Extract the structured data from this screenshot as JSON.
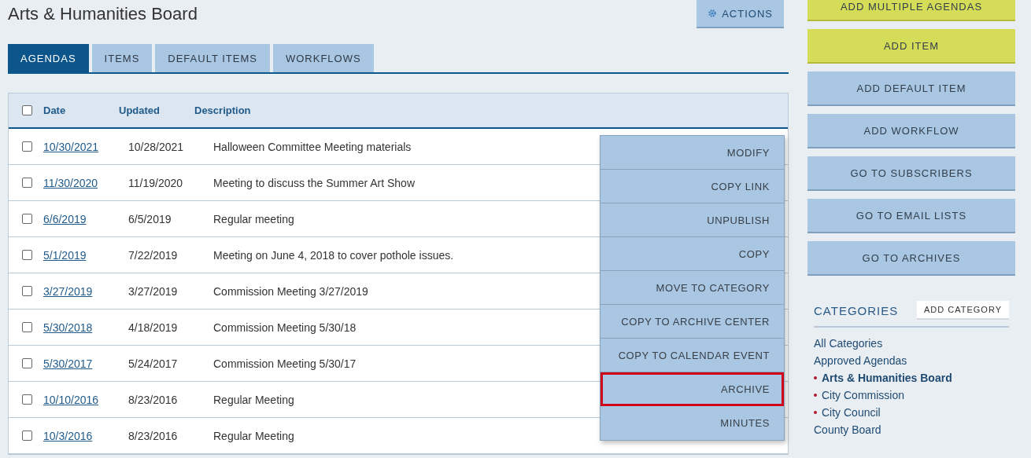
{
  "page": {
    "title": "Arts & Humanities Board",
    "actions_button": "ACTIONS"
  },
  "tabs": [
    {
      "label": "AGENDAS",
      "selected": true
    },
    {
      "label": "ITEMS",
      "selected": false
    },
    {
      "label": "DEFAULT ITEMS",
      "selected": false
    },
    {
      "label": "WORKFLOWS",
      "selected": false
    }
  ],
  "table": {
    "select_all_checked": false,
    "columns": [
      "Date",
      "Updated",
      "Description"
    ],
    "rows": [
      {
        "date": "10/30/2021",
        "updated": "10/28/2021",
        "description": "Halloween Committee Meeting materials",
        "checked": false
      },
      {
        "date": "11/30/2020",
        "updated": "11/19/2020",
        "description": "Meeting to discuss the Summer Art Show",
        "checked": false
      },
      {
        "date": "6/6/2019",
        "updated": "6/5/2019",
        "description": "Regular meeting",
        "checked": false
      },
      {
        "date": "5/1/2019",
        "updated": "7/22/2019",
        "description": "Meeting on June 4, 2018 to cover pothole issues.",
        "checked": false
      },
      {
        "date": "3/27/2019",
        "updated": "3/27/2019",
        "description": "Commission Meeting 3/27/2019",
        "checked": false
      },
      {
        "date": "5/30/2018",
        "updated": "4/18/2019",
        "description": "Commission Meeting 5/30/18",
        "checked": false
      },
      {
        "date": "5/30/2017",
        "updated": "5/24/2017",
        "description": "Commission Meeting 5/30/17",
        "checked": false
      },
      {
        "date": "10/10/2016",
        "updated": "8/23/2016",
        "description": "Regular Meeting",
        "checked": false
      },
      {
        "date": "10/3/2016",
        "updated": "8/23/2016",
        "description": "Regular Meeting",
        "checked": false
      }
    ]
  },
  "context_menu": [
    {
      "label": "MODIFY",
      "highlighted": false
    },
    {
      "label": "COPY LINK",
      "highlighted": false
    },
    {
      "label": "UNPUBLISH",
      "highlighted": false
    },
    {
      "label": "COPY",
      "highlighted": false
    },
    {
      "label": "MOVE TO CATEGORY",
      "highlighted": false
    },
    {
      "label": "COPY TO ARCHIVE CENTER",
      "highlighted": false
    },
    {
      "label": "COPY TO CALENDAR EVENT",
      "highlighted": false
    },
    {
      "label": "ARCHIVE",
      "highlighted": true
    },
    {
      "label": "MINUTES",
      "highlighted": false
    }
  ],
  "sidebar": {
    "buttons": [
      {
        "label": "ADD MULTIPLE AGENDAS",
        "kind": "accent"
      },
      {
        "label": "ADD ITEM",
        "kind": "accent"
      },
      {
        "label": "ADD DEFAULT ITEM",
        "kind": "plain"
      },
      {
        "label": "ADD WORKFLOW",
        "kind": "plain"
      },
      {
        "label": "GO TO SUBSCRIBERS",
        "kind": "plain"
      },
      {
        "label": "GO TO EMAIL LISTS",
        "kind": "plain"
      },
      {
        "label": "GO TO ARCHIVES",
        "kind": "plain"
      }
    ],
    "categories_title": "CATEGORIES",
    "add_category": "ADD CATEGORY",
    "categories": [
      {
        "label": "All Categories",
        "selected": false,
        "dot": false
      },
      {
        "label": "Approved Agendas",
        "selected": false,
        "dot": false
      },
      {
        "label": "Arts & Humanities Board",
        "selected": true,
        "dot": true
      },
      {
        "label": "City Commission",
        "selected": false,
        "dot": true
      },
      {
        "label": "City Council",
        "selected": false,
        "dot": true
      },
      {
        "label": "County Board",
        "selected": false,
        "dot": false
      }
    ]
  }
}
